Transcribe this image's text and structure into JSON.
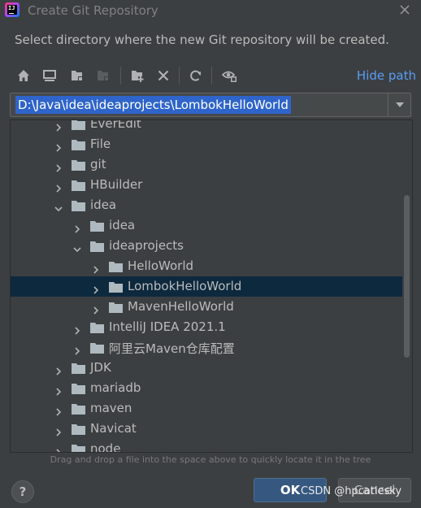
{
  "window": {
    "title": "Create Git Repository",
    "app_icon_text": "IJ"
  },
  "dialog": {
    "description": "Select directory where the new Git repository will be created."
  },
  "toolbar": {
    "buttons": [
      {
        "icon": "home-icon"
      },
      {
        "icon": "desktop-icon"
      },
      {
        "icon": "project-folder-icon"
      },
      {
        "icon": "module-folder-icon"
      },
      {
        "icon": "new-folder-icon"
      },
      {
        "icon": "delete-icon"
      },
      {
        "icon": "refresh-icon"
      },
      {
        "icon": "show-hidden-icon"
      }
    ],
    "hide_path_label": "Hide path"
  },
  "path": {
    "value": "D:\\Java\\idea\\ideaprojects\\LombokHelloWorld"
  },
  "tree": {
    "rows": [
      {
        "label": "EverEdit",
        "depth": 0,
        "expanded": false
      },
      {
        "label": "File",
        "depth": 0,
        "expanded": false
      },
      {
        "label": "git",
        "depth": 0,
        "expanded": false
      },
      {
        "label": "HBuilder",
        "depth": 0,
        "expanded": false
      },
      {
        "label": "idea",
        "depth": 0,
        "expanded": true
      },
      {
        "label": "idea",
        "depth": 1,
        "expanded": false
      },
      {
        "label": "ideaprojects",
        "depth": 1,
        "expanded": true
      },
      {
        "label": "HelloWorld",
        "depth": 2,
        "expanded": false
      },
      {
        "label": "LombokHelloWorld",
        "depth": 2,
        "expanded": false,
        "selected": true
      },
      {
        "label": "MavenHelloWorld",
        "depth": 2,
        "expanded": false
      },
      {
        "label": "IntelliJ IDEA 2021.1",
        "depth": 1,
        "expanded": false
      },
      {
        "label": "阿里云Maven仓库配置",
        "depth": 1,
        "expanded": false
      },
      {
        "label": "JDK",
        "depth": 0,
        "expanded": false
      },
      {
        "label": "mariadb",
        "depth": 0,
        "expanded": false
      },
      {
        "label": "maven",
        "depth": 0,
        "expanded": false
      },
      {
        "label": "Navicat",
        "depth": 0,
        "expanded": false
      },
      {
        "label": "node",
        "depth": 0,
        "expanded": false
      }
    ]
  },
  "hint": "Drag and drop a file into the space above to quickly locate it in the tree",
  "footer": {
    "help_label": "?",
    "ok_label": "OK",
    "cancel_label": "Cancel"
  },
  "watermark": "CSDN @hpcatlesky",
  "colors": {
    "background": "#3c3f41",
    "selection": "#0d293e",
    "path_highlight": "#2f65ca",
    "link": "#589df6",
    "ok_button": "#365880"
  }
}
